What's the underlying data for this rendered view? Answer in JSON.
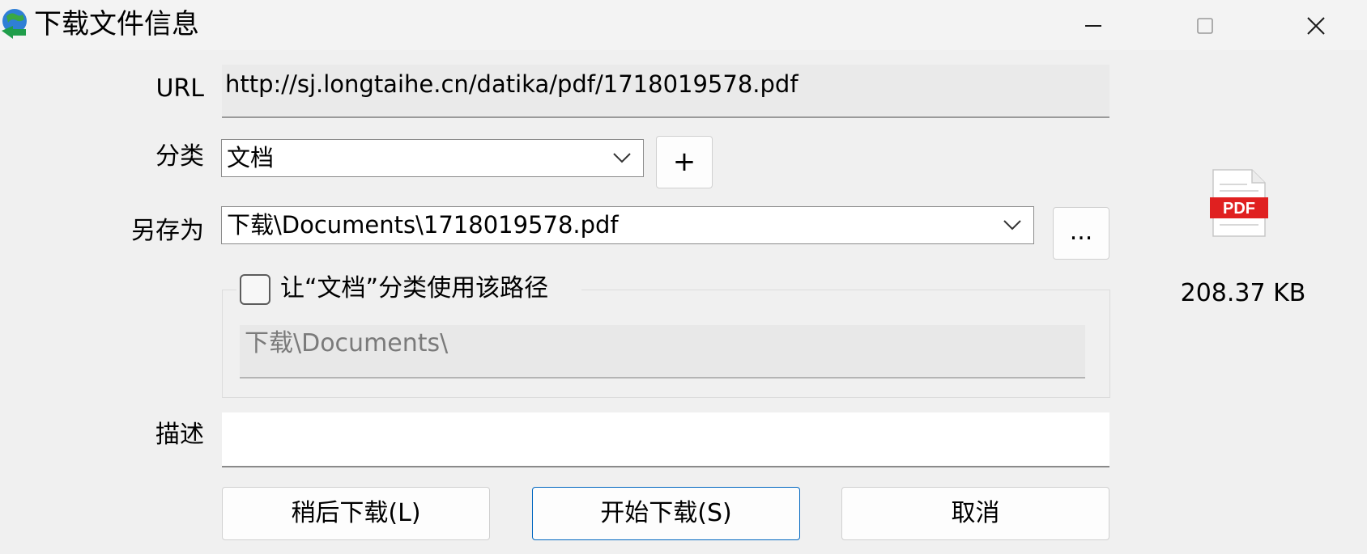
{
  "window": {
    "title": "下载文件信息",
    "app_icon": "globe-download-icon",
    "controls": {
      "minimize": "minimize-icon",
      "maximize": "maximize-icon",
      "close": "close-icon"
    }
  },
  "form": {
    "url_label": "URL",
    "url_value": "http://sj.longtaihe.cn/datika/pdf/1718019578.pdf",
    "category_label": "分类",
    "category_value": "文档",
    "add_category_label": "+",
    "save_as_label": "另存为",
    "save_as_value": "下载\\Documents\\1718019578.pdf",
    "browse_label": "...",
    "use_path_checkbox_label": "让“文档”分类使用该路径",
    "use_path_checked": false,
    "category_path_value": "下载\\Documents\\",
    "description_label": "描述",
    "description_value": ""
  },
  "file_info": {
    "icon": "pdf-file-icon",
    "icon_text": "PDF",
    "size": "208.37  KB"
  },
  "buttons": {
    "later": "稍后下载(L)",
    "start": "开始下载(S)",
    "cancel": "取消"
  },
  "colors": {
    "background": "#f0f0f0",
    "primary_border": "#0067c0",
    "pdf_red": "#e02020"
  }
}
